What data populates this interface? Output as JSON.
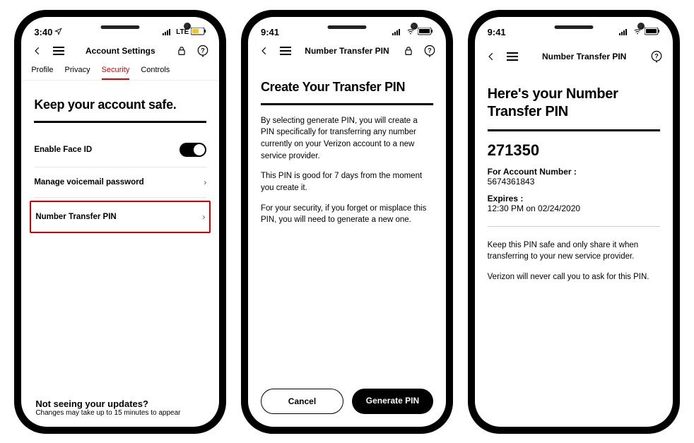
{
  "phone1": {
    "status": {
      "time": "3:40",
      "net": "LTE"
    },
    "header": {
      "title": "Account Settings"
    },
    "tabs": {
      "t0": "Profile",
      "t1": "Privacy",
      "t2": "Security",
      "t3": "Controls"
    },
    "heading": "Keep your account safe.",
    "rows": {
      "faceid": "Enable Face ID",
      "voicemail": "Manage voicemail password",
      "transfer": "Number Transfer PIN"
    },
    "footer": {
      "title": "Not seeing your updates?",
      "sub": "Changes may take up to 15 minutes to appear"
    }
  },
  "phone2": {
    "status": {
      "time": "9:41"
    },
    "header": {
      "title": "Number Transfer PIN"
    },
    "heading": "Create Your Transfer PIN",
    "p1": "By selecting generate PIN, you will create a PIN specifically for transferring any number currently on your Verizon account to a new service provider.",
    "p2": "This PIN is good for 7 days from the moment you create it.",
    "p3": "For your security, if you forget or misplace this PIN, you will need to generate a new one.",
    "buttons": {
      "cancel": "Cancel",
      "generate": "Generate PIN"
    }
  },
  "phone3": {
    "status": {
      "time": "9:41"
    },
    "header": {
      "title": "Number Transfer PIN"
    },
    "heading": "Here's your Number Transfer PIN",
    "pin": "271350",
    "acct_label": "For Account Number :",
    "acct_value": "5674361843",
    "exp_label": "Expires :",
    "exp_value": "12:30 PM on 02/24/2020",
    "note1": "Keep this PIN safe and only share it when transferring to your new service provider.",
    "note2": "Verizon will never call you to ask for this PIN."
  }
}
